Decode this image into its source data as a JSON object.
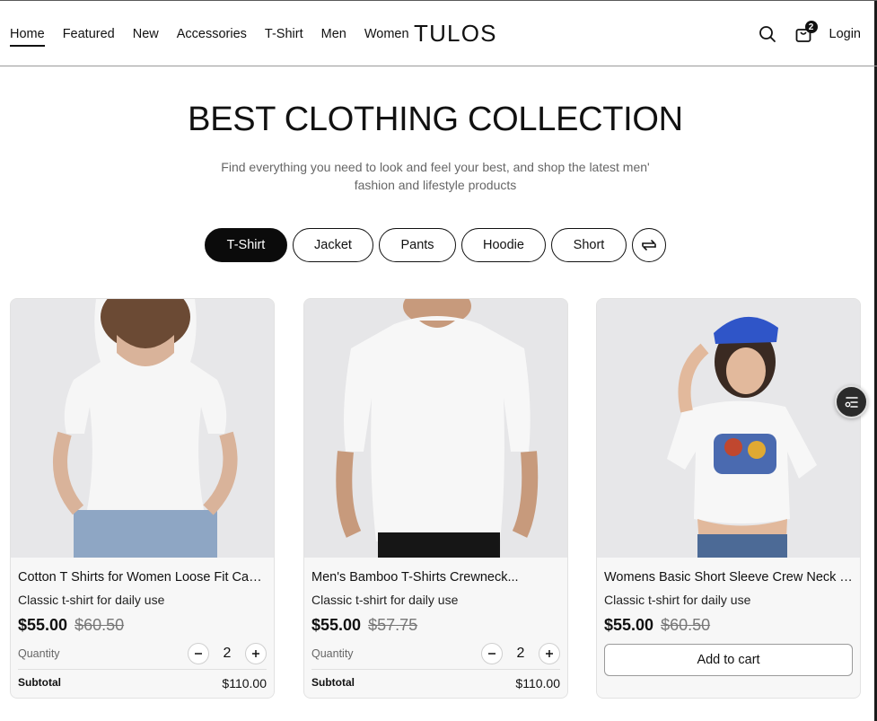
{
  "nav": {
    "items": [
      "Home",
      "Featured",
      "New",
      "Accessories",
      "T-Shirt",
      "Men",
      "Women"
    ],
    "logo": "TULOS",
    "cart_count": "2",
    "login": "Login"
  },
  "hero": {
    "title": "BEST CLOTHING COLLECTION",
    "subtitle": "Find everything you need to look and feel your best, and shop the latest men' fashion and lifestyle products"
  },
  "filters": [
    "T-Shirt",
    "Jacket",
    "Pants",
    "Hoodie",
    "Short"
  ],
  "products": [
    {
      "title": "Cotton T Shirts for Women Loose Fit Casual",
      "desc": "Classic t-shirt for daily use",
      "price": "$55.00",
      "old_price": "$60.50",
      "quantity_label": "Quantity",
      "quantity": "2",
      "subtotal_label": "Subtotal",
      "subtotal": "$110.00"
    },
    {
      "title": "Men's Bamboo T-Shirts Crewneck...",
      "desc": "Classic t-shirt for daily use",
      "price": "$55.00",
      "old_price": "$57.75",
      "quantity_label": "Quantity",
      "quantity": "2",
      "subtotal_label": "Subtotal",
      "subtotal": "$110.00"
    },
    {
      "title": "Womens Basic Short Sleeve Crew Neck T...",
      "desc": "Classic t-shirt for daily use",
      "price": "$55.00",
      "old_price": "$60.50",
      "add_to_cart": "Add to cart"
    }
  ],
  "colors": {
    "primary": "#0b0b0b",
    "background": "#ffffff",
    "card_bg": "#f7f7f7",
    "muted_text": "#666666"
  }
}
